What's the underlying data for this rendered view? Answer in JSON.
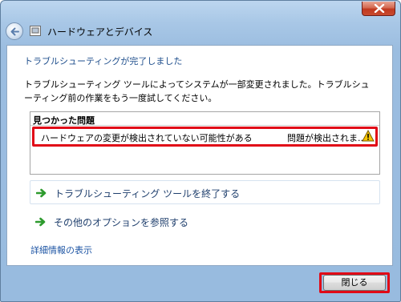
{
  "window": {
    "title": "ハードウェアとデバイス"
  },
  "content": {
    "heading": "トラブルシューティングが完了しました",
    "description": "トラブルシューティング ツールによってシステムが一部変更されました。トラブルシューティング前の作業をもう一度試してください。",
    "found_problems": {
      "title": "見つかった問題",
      "items": [
        {
          "text": "ハードウェアの変更が検出されていない可能性がある",
          "status": "問題が検出されま...",
          "icon": "warning-icon"
        }
      ]
    },
    "actions": [
      {
        "label": "トラブルシューティング ツールを終了する",
        "icon": "green-arrow-icon"
      },
      {
        "label": "その他のオプションを参照する",
        "icon": "green-arrow-icon"
      }
    ],
    "details_link": "詳細情報の表示"
  },
  "footer": {
    "close_label": "閉じる"
  },
  "colors": {
    "highlight": "#e10a17",
    "heading": "#1e4e8c",
    "link": "#1e55a4",
    "action_text": "#1f3f6d",
    "arrow": "#2e9b2e",
    "warning": "#f5c400"
  }
}
